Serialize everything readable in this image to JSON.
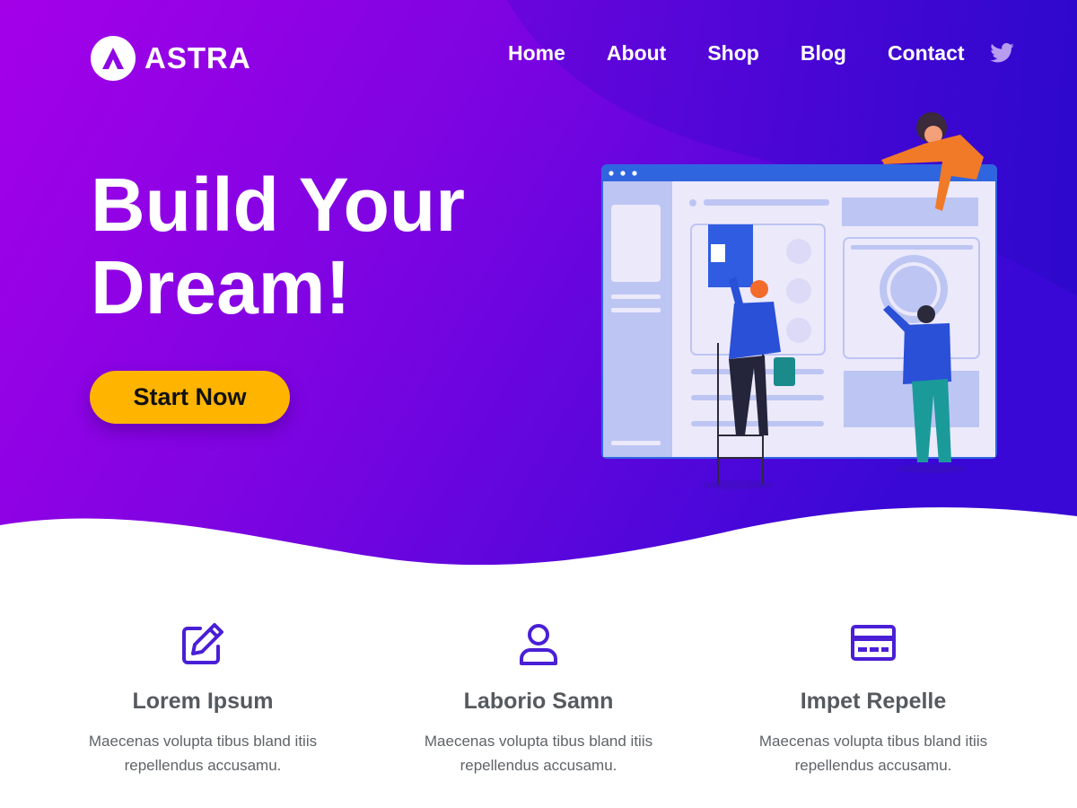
{
  "brand": {
    "name": "ASTRA"
  },
  "nav": {
    "items": [
      "Home",
      "About",
      "Shop",
      "Blog",
      "Contact"
    ]
  },
  "hero": {
    "headline_line1": "Build Your",
    "headline_line2": "Dream!",
    "cta_label": "Start Now"
  },
  "features": [
    {
      "icon": "edit-icon",
      "title": "Lorem Ipsum",
      "desc_line1": "Maecenas volupta tibus bland itiis",
      "desc_line2": "repellendus accusamu."
    },
    {
      "icon": "user-icon",
      "title": "Laborio Samn",
      "desc_line1": "Maecenas volupta tibus bland itiis",
      "desc_line2": "repellendus accusamu."
    },
    {
      "icon": "credit-card-icon",
      "title": "Impet Repelle",
      "desc_line1": "Maecenas volupta tibus bland itiis",
      "desc_line2": "repellendus accusamu."
    }
  ],
  "colors": {
    "gradient_start": "#a000e6",
    "gradient_end": "#3a08d8",
    "cta": "#ffb400",
    "icon": "#4a1fd6",
    "title_text": "#555a5f",
    "body_text": "#5f6468"
  }
}
